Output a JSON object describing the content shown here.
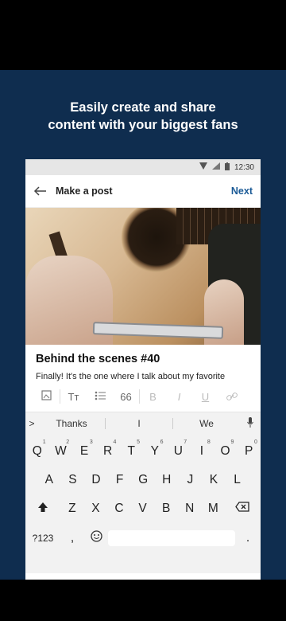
{
  "headline": {
    "line1": "Easily create and share",
    "line2": "content with your biggest fans"
  },
  "status_bar": {
    "time": "12:30",
    "icons": [
      "wifi-icon",
      "signal-icon",
      "battery-icon"
    ]
  },
  "appbar": {
    "back_icon": "back-arrow-icon",
    "title": "Make a post",
    "next_label": "Next"
  },
  "post": {
    "title": "Behind the scenes #40",
    "body": "Finally! It's the one where I talk about my favorite"
  },
  "format_toolbar": {
    "image_icon": "image-icon",
    "text_style": "Tт",
    "list_icon": "bullet-list-icon",
    "quote": "66",
    "bold": "B",
    "italic": "I",
    "underline": "U",
    "link_icon": "link-icon"
  },
  "suggestions": {
    "chevron": ">",
    "items": [
      "Thanks",
      "I",
      "We"
    ],
    "mic_icon": "mic-icon"
  },
  "keyboard": {
    "row1": [
      [
        "Q",
        "1"
      ],
      [
        "W",
        "2"
      ],
      [
        "E",
        "3"
      ],
      [
        "R",
        "4"
      ],
      [
        "T",
        "5"
      ],
      [
        "Y",
        "6"
      ],
      [
        "U",
        "7"
      ],
      [
        "I",
        "8"
      ],
      [
        "O",
        "9"
      ],
      [
        "P",
        "0"
      ]
    ],
    "row2": [
      "A",
      "S",
      "D",
      "F",
      "G",
      "H",
      "J",
      "K",
      "L"
    ],
    "row3": [
      "Z",
      "X",
      "C",
      "V",
      "B",
      "N",
      "M"
    ],
    "shift_icon": "shift-icon",
    "backspace_icon": "backspace-icon",
    "symbols": "?123",
    "comma": ",",
    "emoji_icon": "emoji-icon",
    "period": "."
  },
  "colors": {
    "background": "#0f2d4f",
    "next": "#1a5a96"
  }
}
